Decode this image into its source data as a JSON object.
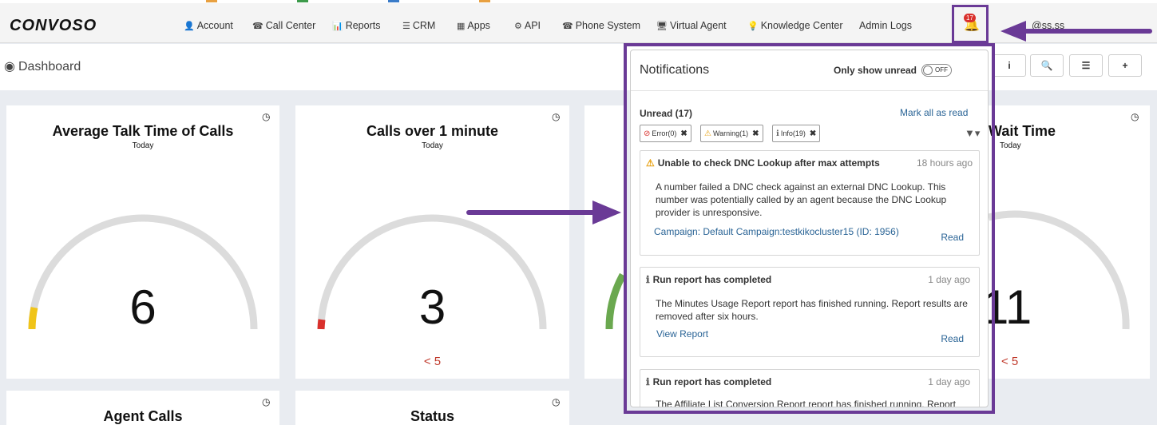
{
  "brand": {
    "logo": "CONVOSO"
  },
  "nav": {
    "items": [
      {
        "label": "Account",
        "icon": "👤"
      },
      {
        "label": "Call Center",
        "icon": "☎"
      },
      {
        "label": "Reports",
        "icon": "📊"
      },
      {
        "label": "CRM",
        "icon": "☰"
      },
      {
        "label": "Apps",
        "icon": "▦"
      },
      {
        "label": "API",
        "icon": "⚙"
      },
      {
        "label": "Phone System",
        "icon": "☎"
      },
      {
        "label": "Virtual Agent",
        "icon": "🖥"
      },
      {
        "label": "Knowledge Center",
        "icon": "💡"
      },
      {
        "label": "Admin Logs",
        "icon": ""
      }
    ],
    "notification_count": "17",
    "user_email": "@ss.ss"
  },
  "dashboard": {
    "title": "Dashboard",
    "toolbar": {
      "info": "i",
      "search": "🔍",
      "list": "☰",
      "add": "+"
    }
  },
  "cards": [
    {
      "title": "Average Talk Time of Calls",
      "subtitle": "Today",
      "value": "6",
      "threshold": "",
      "fill_color": "#f0c419"
    },
    {
      "title": "Calls over 1 minute",
      "subtitle": "Today",
      "value": "3",
      "threshold": "< 5",
      "fill_color": "#d9302c"
    },
    {
      "title": "",
      "subtitle": "",
      "value": "",
      "threshold": "",
      "fill_color": "#6aa84f"
    },
    {
      "title": "Wait Time",
      "subtitle": "Today",
      "value": "11",
      "threshold": "< 5",
      "fill_color": "#d9302c"
    },
    {
      "title": "Agent Calls",
      "subtitle": ""
    },
    {
      "title": "Status",
      "subtitle": ""
    }
  ],
  "notifications": {
    "title": "Notifications",
    "only_show_unread": "Only show unread",
    "toggle_state": "OFF",
    "unread_label": "Unread (17)",
    "mark_all_label": "Mark all as read",
    "filters": [
      {
        "label": "Error(0)",
        "icon": "⊘",
        "color": "#d9302c"
      },
      {
        "label": "Warning(1)",
        "icon": "⚠",
        "color": "#e8a317"
      },
      {
        "label": "Info(19)",
        "icon": "ℹ",
        "color": "#666666"
      }
    ],
    "items": [
      {
        "icon": "⚠",
        "icon_color": "#e8a317",
        "title": "Unable to check DNC Lookup after max attempts",
        "time": "18 hours ago",
        "body": "A number failed a DNC check against an external DNC Lookup. This number was potentially called by an agent because the DNC Lookup provider is unresponsive.",
        "link": "Campaign: Default Campaign:testkikocluster15 (ID: 1956)",
        "action": "Read"
      },
      {
        "icon": "ℹ",
        "icon_color": "#666666",
        "title": "Run report has completed",
        "time": "1 day ago",
        "body": "The Minutes Usage Report report has finished running. Report results are removed after six hours.",
        "link": "View Report",
        "action": "Read"
      },
      {
        "icon": "ℹ",
        "icon_color": "#666666",
        "title": "Run report has completed",
        "time": "1 day ago",
        "body": "The Affiliate List Conversion Report report has finished running. Report",
        "link": "",
        "action": ""
      }
    ]
  }
}
